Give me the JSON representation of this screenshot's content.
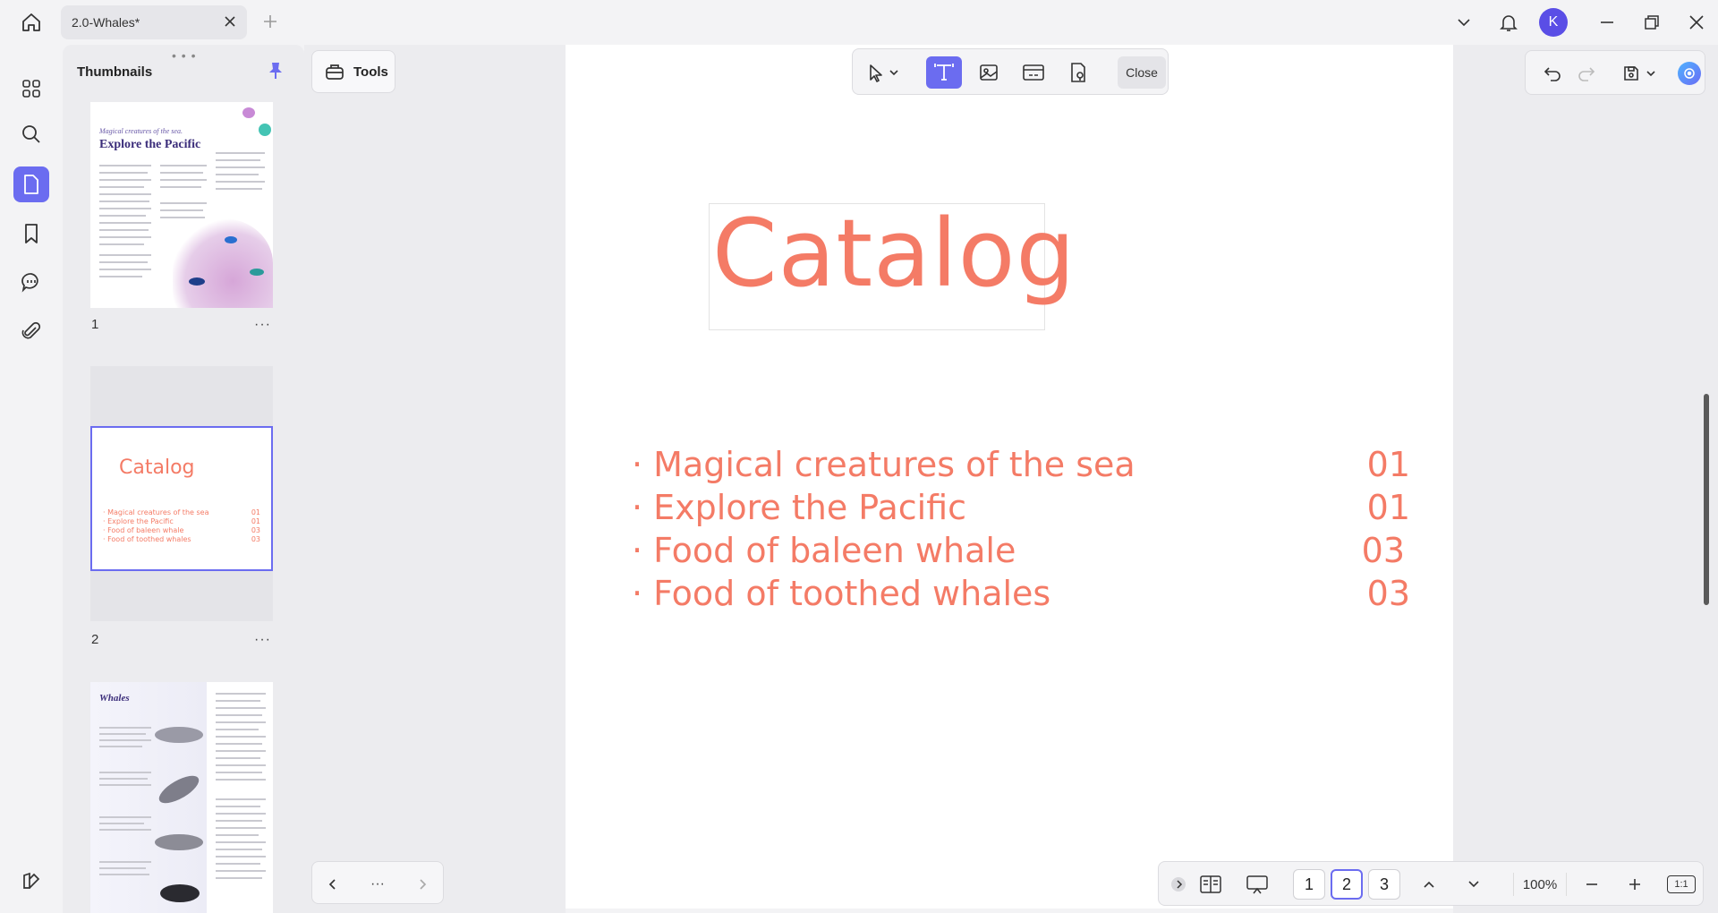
{
  "titlebar": {
    "tab_title": "2.0-Whales*",
    "avatar_letter": "K"
  },
  "thumbnails": {
    "title": "Thumbnails",
    "grip": "• • •",
    "pages": [
      {
        "number": "1",
        "heading": "Explore the Pacific",
        "subheading": "Magical creatures of the sea.",
        "more": "···"
      },
      {
        "number": "2",
        "heading": "Catalog",
        "more": "···",
        "items": [
          {
            "label": "· Magical creatures of the sea",
            "num": "01"
          },
          {
            "label": "· Explore the Pacific",
            "num": "01"
          },
          {
            "label": "· Food of baleen whale",
            "num": "03"
          },
          {
            "label": "· Food of toothed whales",
            "num": "03"
          }
        ]
      },
      {
        "number": "3",
        "heading": "Whales",
        "more": "···"
      }
    ]
  },
  "tools": {
    "label": "Tools"
  },
  "nav": {
    "more": "···"
  },
  "edit_toolbar": {
    "close_label": "Close"
  },
  "document": {
    "title": "Catalog",
    "toc": [
      {
        "label": "· Magical creatures of the sea",
        "num": "01"
      },
      {
        "label": "· Explore the Pacific",
        "num": "01"
      },
      {
        "label": "· Food of baleen whale",
        "num": "03"
      },
      {
        "label": "· Food of toothed whales",
        "num": "03"
      }
    ]
  },
  "bottom": {
    "pages": [
      "1",
      "2",
      "3"
    ],
    "current_page": "2",
    "zoom": "100%",
    "fit_label": "1:1"
  },
  "colors": {
    "accent": "#6b6cf0",
    "doc_text": "#f47b66"
  }
}
